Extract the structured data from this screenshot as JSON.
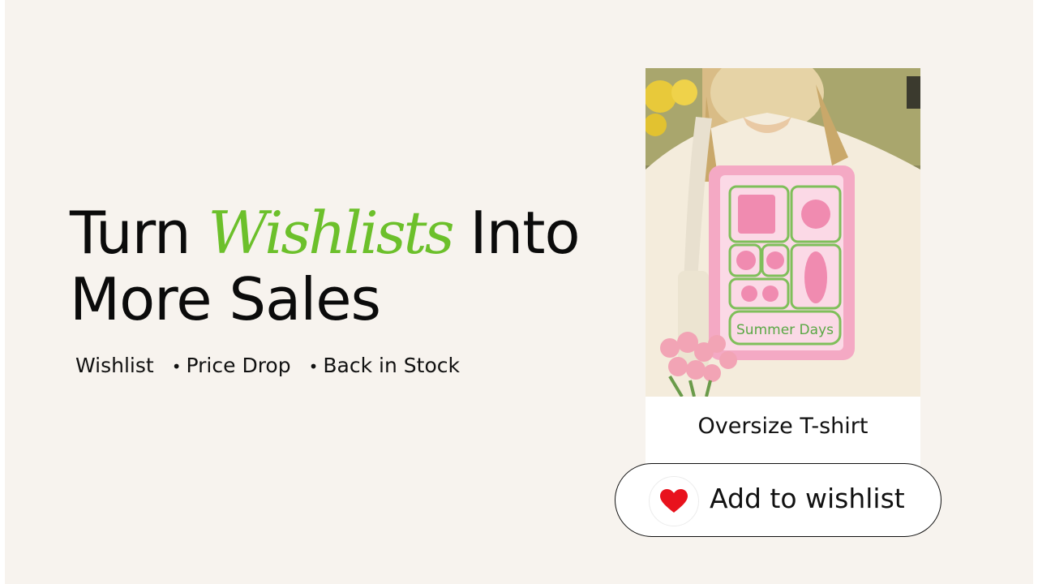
{
  "headline": {
    "line1_before": "Turn ",
    "accent_word": "Wishlists",
    "line1_after": " Into",
    "line2": "More Sales"
  },
  "features": [
    {
      "bullet": "",
      "label": "Wishlist"
    },
    {
      "bullet": "•",
      "label": "Price Drop"
    },
    {
      "bullet": "•",
      "label": "Back in Stock"
    }
  ],
  "product": {
    "name": "Oversize T-shirt",
    "print_text": "Summer Days"
  },
  "wishlist_button": {
    "label": "Add to wishlist",
    "icon": "heart-icon"
  },
  "colors": {
    "background": "#f7f3ee",
    "accent_green": "#6cc02b",
    "heart_red": "#e8121d",
    "print_pink": "#f4a9c4",
    "print_green": "#7fbf5a"
  }
}
